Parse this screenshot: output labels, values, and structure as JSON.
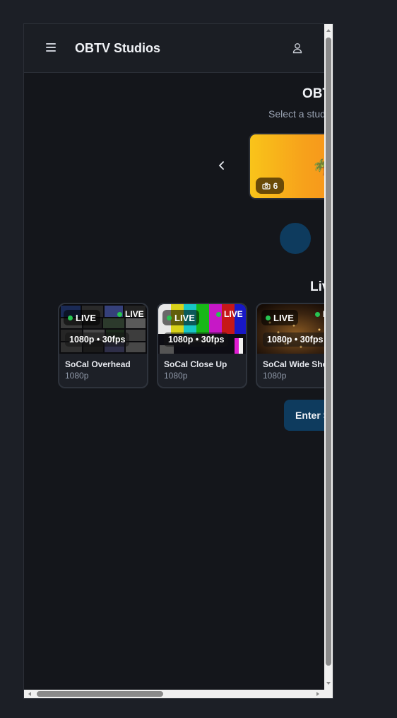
{
  "header": {
    "brand": "OBTV Studios",
    "menu_icon": "hamburger-menu-icon",
    "account_icon": "user-icon"
  },
  "page": {
    "title": "OBT",
    "subtitle": "Select a stud"
  },
  "carousel": {
    "prev_icon": "chevron-left-icon",
    "studio_card": {
      "emoji": "🌴",
      "photo_count": "6",
      "photo_icon": "camera-icon",
      "gradient": [
        "#f9c41a",
        "#f7901c"
      ]
    }
  },
  "section": {
    "title": "Liv"
  },
  "cameras": [
    {
      "name": "SoCal Overhead",
      "resolution": "1080p",
      "live_label": "LIVE",
      "live_label_corner": "LIVE",
      "format": "1080p • 30fps"
    },
    {
      "name": "SoCal Close Up",
      "resolution": "1080p",
      "live_label": "LIVE",
      "live_label_corner": "LIVE",
      "format": "1080p • 30fps"
    },
    {
      "name": "SoCal Wide Sho",
      "resolution": "1080p",
      "live_label": "LIVE",
      "live_label_corner": "L",
      "format": "1080p • 30fps"
    }
  ],
  "enter_button": {
    "label": "Enter S"
  },
  "colors": {
    "accent": "#0e3b5e",
    "live_dot": "#27c452",
    "background": "#14161b"
  }
}
